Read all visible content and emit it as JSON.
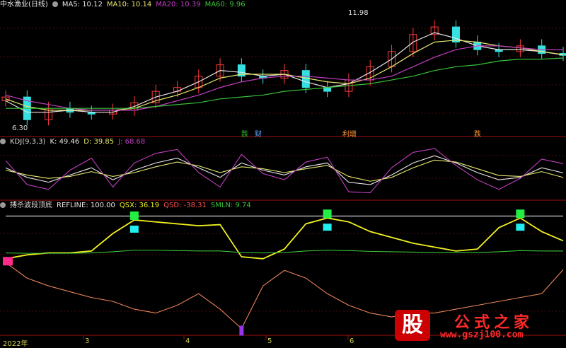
{
  "header": {
    "title": "中水渔业(日线)",
    "ma5": "MA5: 10.12",
    "ma10": "MA10: 10.14",
    "ma20": "MA20: 10.39",
    "ma60": "MA60: 9.96",
    "high_label": "11.98",
    "low_label": "6.30"
  },
  "signals": [
    {
      "text": "跌",
      "color": "#27c427"
    },
    {
      "text": "财",
      "color": "#66aaff"
    },
    {
      "text": "利增",
      "color": "#ff9933"
    },
    {
      "text": "跌",
      "color": "#ff9933"
    }
  ],
  "kdj_bar": {
    "title": "KDJ(9,3,3)",
    "k": "K: 49.46",
    "d": "D: 39.85",
    "j": "J: 68.68"
  },
  "ind_bar": {
    "title": "搏杀波段顶底",
    "refline": "REFLINE: 100.00",
    "qsx": "QSX: 36.19",
    "qsd": "QSD: -38.31",
    "smln": "SMLN: 9.74"
  },
  "xaxis": {
    "labels": [
      "2022年",
      "3",
      "4",
      "5",
      "6"
    ]
  },
  "watermark": {
    "logo": "股",
    "title": "公式之家",
    "url": "www.gszj100.com"
  },
  "colors": {
    "up": "#ff3b3b",
    "down": "#35e0e0",
    "ma5": "#e6e6e6",
    "ma10": "#e6e66e",
    "ma20": "#c040c0",
    "ma60": "#3ac23a",
    "kdj_k": "#e8e8e8",
    "kdj_d": "#e8e870",
    "kdj_j": "#c040c0",
    "qsx": "#f0f020",
    "smln": "#3ac23a",
    "qsd": "#e8845a",
    "sep": "#a01010"
  },
  "chart_data": [
    {
      "type": "line",
      "title": "中水渔业(日线)",
      "x": [
        "2022-01-04",
        "2022-01-11",
        "2022-01-18",
        "2022-01-25",
        "2022-02-08",
        "2022-02-15",
        "2022-02-22",
        "2022-03-01",
        "2022-03-08",
        "2022-03-15",
        "2022-03-22",
        "2022-03-29",
        "2022-04-06",
        "2022-04-13",
        "2022-04-20",
        "2022-04-27",
        "2022-05-06",
        "2022-05-13",
        "2022-05-20",
        "2022-05-27",
        "2022-06-02",
        "2022-06-10",
        "2022-06-17",
        "2022-06-24",
        "2022-07-01",
        "2022-07-08",
        "2022-07-15"
      ],
      "series": [
        {
          "name": "close",
          "values": [
            7.9,
            6.7,
            7.3,
            7.1,
            7.0,
            7.2,
            7.6,
            8.2,
            8.4,
            9.0,
            9.6,
            9.0,
            8.9,
            9.3,
            8.4,
            8.2,
            8.8,
            9.5,
            10.3,
            11.2,
            11.6,
            10.8,
            10.4,
            10.3,
            10.6,
            10.2,
            10.1
          ]
        },
        {
          "name": "MA5",
          "values": [
            7.7,
            7.1,
            7.1,
            7.2,
            7.1,
            7.1,
            7.4,
            7.9,
            8.2,
            8.7,
            9.3,
            9.2,
            9.0,
            9.1,
            8.7,
            8.4,
            8.6,
            9.2,
            9.9,
            10.8,
            11.3,
            11.0,
            10.6,
            10.4,
            10.4,
            10.3,
            10.12
          ]
        },
        {
          "name": "MA10",
          "values": [
            7.8,
            7.4,
            7.2,
            7.2,
            7.2,
            7.2,
            7.3,
            7.7,
            8.0,
            8.4,
            8.9,
            9.1,
            9.1,
            9.1,
            8.9,
            8.7,
            8.6,
            8.9,
            9.5,
            10.2,
            10.8,
            10.9,
            10.8,
            10.6,
            10.5,
            10.3,
            10.14
          ]
        },
        {
          "name": "MA20",
          "values": [
            8.0,
            7.7,
            7.5,
            7.3,
            7.2,
            7.2,
            7.2,
            7.4,
            7.7,
            8.0,
            8.4,
            8.7,
            8.9,
            9.0,
            9.0,
            8.9,
            8.8,
            8.8,
            9.0,
            9.5,
            10.0,
            10.4,
            10.6,
            10.6,
            10.5,
            10.4,
            10.39
          ]
        },
        {
          "name": "MA60",
          "values": [
            7.3,
            7.3,
            7.3,
            7.3,
            7.3,
            7.3,
            7.3,
            7.4,
            7.5,
            7.6,
            7.8,
            7.9,
            8.0,
            8.2,
            8.3,
            8.4,
            8.5,
            8.6,
            8.8,
            9.0,
            9.3,
            9.5,
            9.6,
            9.8,
            9.9,
            9.9,
            9.96
          ]
        }
      ],
      "annotations": [
        {
          "text": "11.98",
          "x": "2022-06-02",
          "y": 11.98
        },
        {
          "text": "6.30",
          "x": "2022-01-11",
          "y": 6.3
        }
      ]
    },
    {
      "type": "line",
      "title": "KDJ(9,3,3)",
      "x": [
        "t0",
        "t1",
        "t2",
        "t3",
        "t4",
        "t5",
        "t6",
        "t7",
        "t8",
        "t9",
        "t10",
        "t11",
        "t12",
        "t13",
        "t14",
        "t15",
        "t16",
        "t17",
        "t18",
        "t19",
        "t20",
        "t21",
        "t22",
        "t23",
        "t24",
        "t25",
        "t26"
      ],
      "series": [
        {
          "name": "K",
          "values": [
            60,
            40,
            30,
            45,
            60,
            35,
            55,
            70,
            80,
            60,
            40,
            70,
            55,
            45,
            62,
            70,
            30,
            25,
            45,
            70,
            85,
            70,
            50,
            35,
            40,
            60,
            49.46
          ]
        },
        {
          "name": "D",
          "values": [
            55,
            45,
            38,
            42,
            52,
            42,
            50,
            62,
            72,
            64,
            50,
            62,
            58,
            50,
            58,
            65,
            42,
            32,
            40,
            60,
            76,
            72,
            58,
            44,
            42,
            52,
            39.85
          ]
        },
        {
          "name": "J",
          "values": [
            75,
            25,
            15,
            55,
            80,
            20,
            70,
            90,
            98,
            50,
            20,
            88,
            48,
            35,
            72,
            82,
            10,
            8,
            60,
            92,
            100,
            65,
            35,
            15,
            38,
            78,
            68.68
          ]
        }
      ]
    },
    {
      "type": "line",
      "title": "搏杀波段顶底",
      "x": [
        "t0",
        "t1",
        "t2",
        "t3",
        "t4",
        "t5",
        "t6",
        "t7",
        "t8",
        "t9",
        "t10",
        "t11",
        "t12",
        "t13",
        "t14",
        "t15",
        "t16",
        "t17",
        "t18",
        "t19",
        "t20",
        "t21",
        "t22",
        "t23",
        "t24",
        "t25",
        "t26"
      ],
      "series": [
        {
          "name": "REFLINE",
          "values": [
            100,
            100,
            100,
            100,
            100,
            100,
            100,
            100,
            100,
            100,
            100,
            100,
            100,
            100,
            100,
            100,
            100,
            100,
            100,
            100,
            100,
            100,
            100,
            100,
            100,
            100,
            100
          ]
        },
        {
          "name": "QSX",
          "values": [
            -10,
            0,
            5,
            5,
            10,
            55,
            90,
            85,
            80,
            75,
            78,
            -5,
            -10,
            15,
            80,
            95,
            85,
            60,
            45,
            30,
            20,
            10,
            15,
            70,
            95,
            60,
            36.19
          ]
        },
        {
          "name": "QSD",
          "values": [
            -20,
            -60,
            -80,
            -95,
            -110,
            -120,
            -140,
            -150,
            -130,
            -100,
            -140,
            -190,
            -80,
            -40,
            -60,
            -100,
            -130,
            -150,
            -160,
            -150,
            -150,
            -140,
            -130,
            -120,
            -110,
            -100,
            -38.31
          ]
        },
        {
          "name": "SMLN",
          "values": [
            5,
            4,
            4,
            4,
            5,
            8,
            12,
            12,
            11,
            10,
            10,
            6,
            5,
            6,
            10,
            12,
            11,
            9,
            8,
            7,
            6,
            6,
            6,
            8,
            11,
            10,
            9.74
          ]
        }
      ]
    }
  ]
}
